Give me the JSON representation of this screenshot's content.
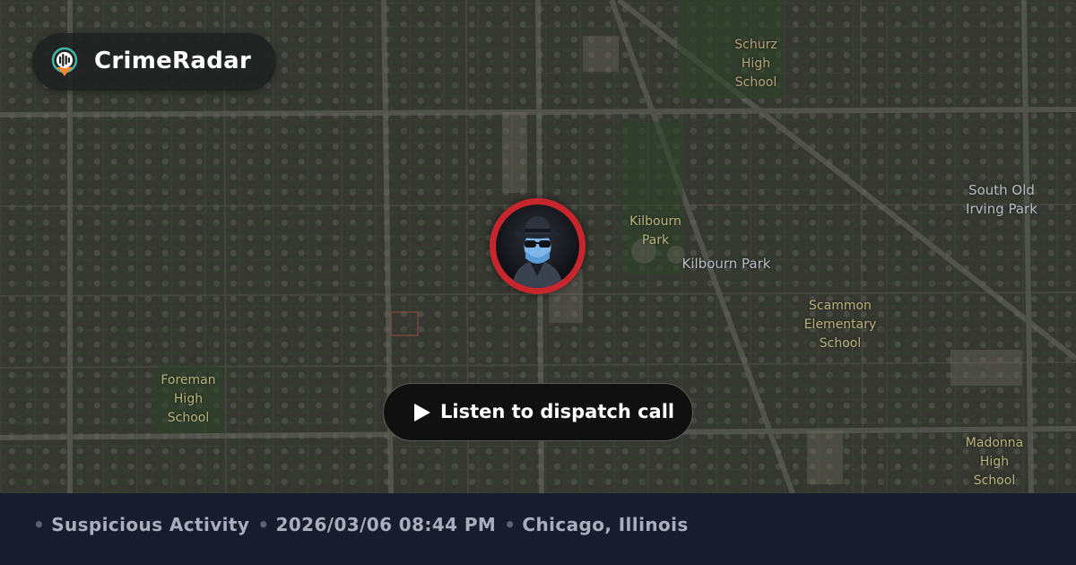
{
  "brand": {
    "name": "CrimeRadar",
    "logo_icon": "radar-pin-icon"
  },
  "incident": {
    "avatar_icon": "masked-hat-figure-icon",
    "ring_color": "#c7262d"
  },
  "audio": {
    "button_label": "Listen to dispatch call",
    "icon": "play-icon"
  },
  "footer": {
    "separator": "•",
    "category": "Suspicious Activity",
    "datetime": "2026/03/06 08:44 PM",
    "location": "Chicago, Illinois"
  },
  "map_labels": {
    "schurz": "Schurz\nHigh\nSchool",
    "kilbourn_short": "Kilbourn\nPark",
    "kilbourn": "Kilbourn Park",
    "south_old_irving": "South Old\nIrving Park",
    "scammon": "Scammon\nElementary\nSchool",
    "foreman": "Foreman\nHigh\nSchool",
    "madonna": "Madonna\nHigh\nSchool"
  },
  "colors": {
    "footer_bg": "#171d2d",
    "footer_text": "#a9afbd",
    "accent_red": "#c7262d"
  }
}
